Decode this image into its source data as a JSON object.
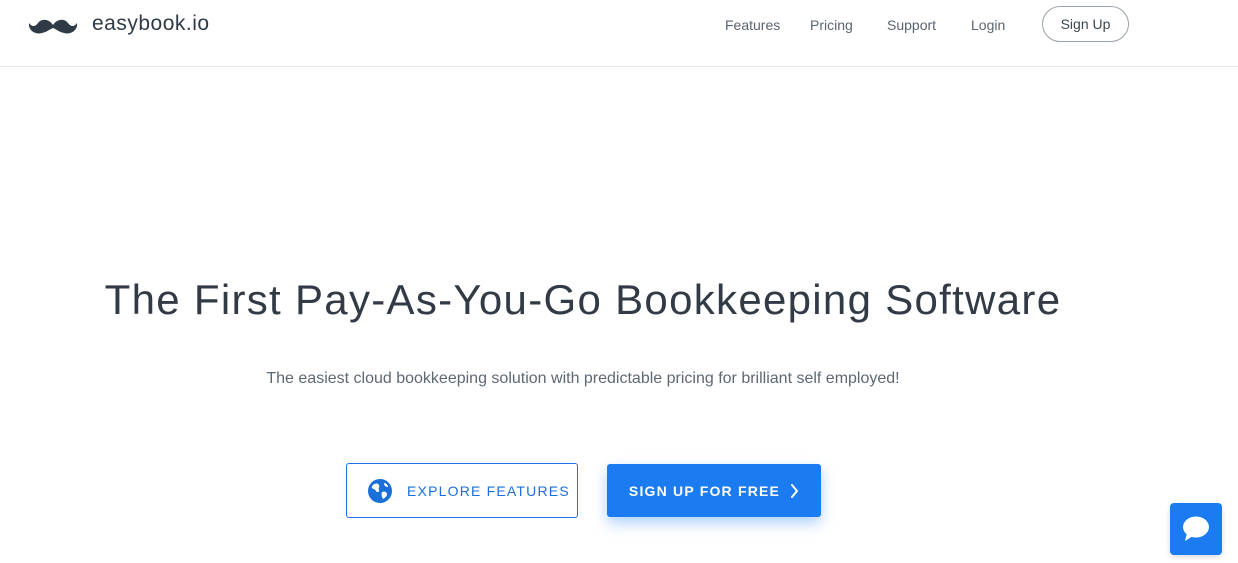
{
  "brand": {
    "name": "easybook.io",
    "logo_icon": "mustache-icon"
  },
  "nav": {
    "links": [
      "Features",
      "Pricing",
      "Support",
      "Login"
    ],
    "signup_label": "Sign Up"
  },
  "hero": {
    "title": "The First Pay-As-You-Go Bookkeeping Software",
    "subtitle": "The easiest cloud bookkeeping solution with predictable pricing for brilliant self employed!"
  },
  "actions": {
    "explore_label": "EXPLORE FEATURES",
    "explore_icon": "globe-icon",
    "signup_label": "SIGN UP FOR FREE",
    "signup_icon": "chevron-right-icon"
  },
  "chat": {
    "icon": "chat-bubble-icon"
  },
  "colors": {
    "accent": "#1a7cf0",
    "text_dark": "#313a45",
    "text_muted": "#5e6873",
    "border": "#e3e6ea"
  }
}
